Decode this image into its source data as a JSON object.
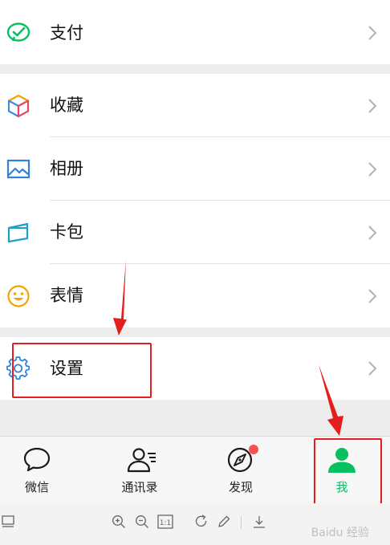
{
  "menu": {
    "pay": {
      "label": "支付",
      "icon": "wechat-pay-icon"
    },
    "favorites": {
      "label": "收藏",
      "icon": "cube-icon"
    },
    "album": {
      "label": "相册",
      "icon": "picture-icon"
    },
    "cards": {
      "label": "卡包",
      "icon": "card-icon"
    },
    "stickers": {
      "label": "表情",
      "icon": "smiley-icon"
    },
    "settings": {
      "label": "设置",
      "icon": "gear-icon"
    }
  },
  "tabs": [
    {
      "label": "微信",
      "icon": "chat-bubble-icon"
    },
    {
      "label": "通讯录",
      "icon": "contacts-icon"
    },
    {
      "label": "发现",
      "icon": "compass-icon",
      "badge": true
    },
    {
      "label": "我",
      "icon": "person-icon",
      "active": true
    }
  ],
  "colors": {
    "accent": "#07c160",
    "annotation": "#e41e1e",
    "badge": "#fa5151"
  },
  "watermark": "Baidu 经验"
}
